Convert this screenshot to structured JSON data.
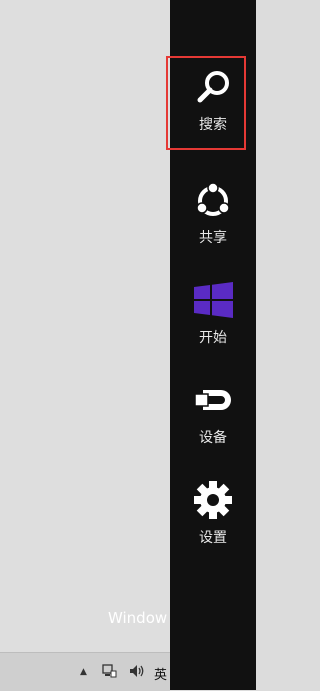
{
  "desktop": {
    "watermark_text": "Window"
  },
  "taskbar": {
    "show_hidden_icons": "▲",
    "ime_indicator": "英"
  },
  "charms": {
    "items": [
      {
        "label": "搜索",
        "icon": "search-icon"
      },
      {
        "label": "共享",
        "icon": "share-icon"
      },
      {
        "label": "开始",
        "icon": "windows-logo-icon"
      },
      {
        "label": "设备",
        "icon": "devices-icon"
      },
      {
        "label": "设置",
        "icon": "settings-gear-icon"
      }
    ],
    "selected_index": 0,
    "highlight_color": "#e53935",
    "start_logo_color": "#5a2bc4",
    "bar_background": "#111111"
  }
}
